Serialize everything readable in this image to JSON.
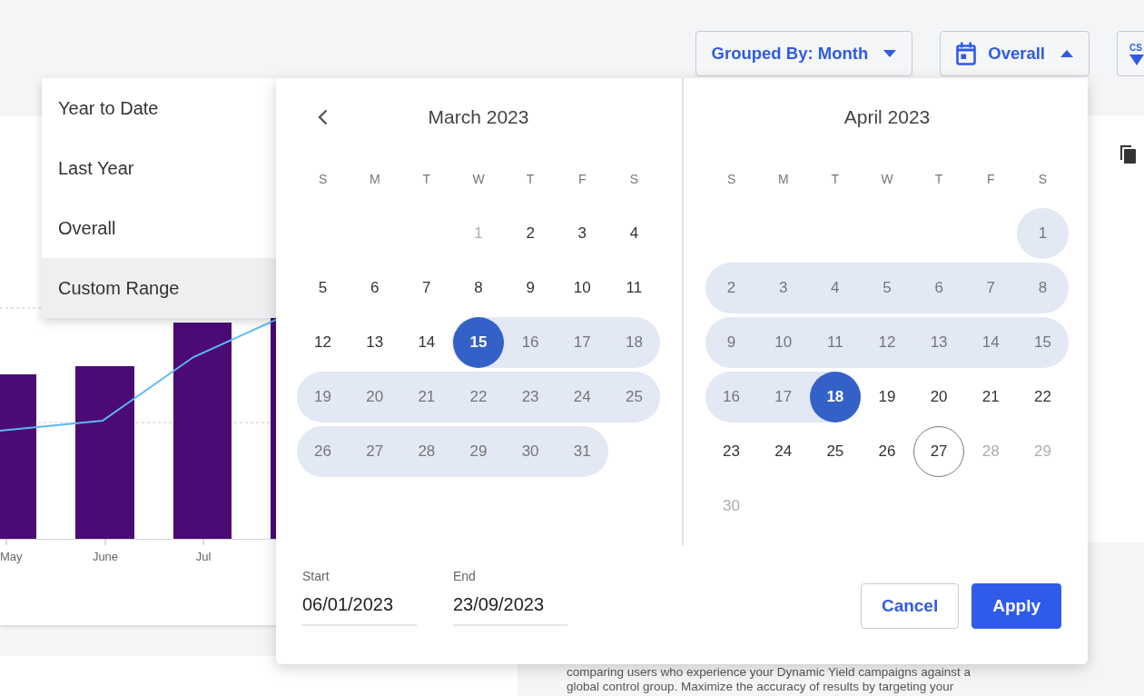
{
  "toolbar": {
    "group_by": {
      "label": "Grouped By: Month",
      "expanded": false
    },
    "date_range": {
      "label": "Overall",
      "expanded": true
    },
    "export": {
      "label": "CS"
    }
  },
  "range_menu": {
    "items": [
      {
        "label": "Year to Date",
        "selected": false
      },
      {
        "label": "Last Year",
        "selected": false
      },
      {
        "label": "Overall",
        "selected": false
      },
      {
        "label": "Custom Range",
        "selected": true
      }
    ]
  },
  "chart": {
    "x_labels": [
      "May",
      "June",
      "Jul"
    ]
  },
  "calendar": {
    "months": [
      {
        "title": "March 2023",
        "prev_arrow": true,
        "weekdays": [
          "S",
          "M",
          "T",
          "W",
          "T",
          "F",
          "S"
        ],
        "weeks": [
          {
            "kind": "first",
            "days": [
              {
                "day": "1",
                "selected": false,
                "in_range": false,
                "today": false,
                "disabled": true
              },
              {
                "day": "2",
                "selected": false,
                "in_range": false,
                "today": false,
                "disabled": false
              },
              {
                "day": "3",
                "selected": false,
                "in_range": false,
                "today": false,
                "disabled": false
              },
              {
                "day": "4",
                "selected": false,
                "in_range": false,
                "today": false,
                "disabled": false
              }
            ]
          },
          {
            "kind": "full",
            "days": [
              {
                "day": "5",
                "selected": false,
                "in_range": false,
                "today": false,
                "disabled": false
              },
              {
                "day": "6",
                "selected": false,
                "in_range": false,
                "today": false,
                "disabled": false
              },
              {
                "day": "7",
                "selected": false,
                "in_range": false,
                "today": false,
                "disabled": false
              },
              {
                "day": "8",
                "selected": false,
                "in_range": false,
                "today": false,
                "disabled": false
              },
              {
                "day": "9",
                "selected": false,
                "in_range": false,
                "today": false,
                "disabled": false
              },
              {
                "day": "10",
                "selected": false,
                "in_range": false,
                "today": false,
                "disabled": false
              },
              {
                "day": "11",
                "selected": false,
                "in_range": false,
                "today": false,
                "disabled": false
              }
            ]
          },
          {
            "kind": "full",
            "days": [
              {
                "day": "12",
                "selected": false,
                "in_range": false,
                "today": false,
                "disabled": false
              },
              {
                "day": "13",
                "selected": false,
                "in_range": false,
                "today": false,
                "disabled": false
              },
              {
                "day": "14",
                "selected": false,
                "in_range": false,
                "today": false,
                "disabled": false
              },
              {
                "day": "15",
                "selected": true,
                "in_range": true,
                "today": false,
                "disabled": false
              },
              {
                "day": "16",
                "selected": false,
                "in_range": true,
                "today": false,
                "disabled": false
              },
              {
                "day": "17",
                "selected": false,
                "in_range": true,
                "today": false,
                "disabled": false
              },
              {
                "day": "18",
                "selected": false,
                "in_range": true,
                "today": false,
                "disabled": false
              }
            ]
          },
          {
            "kind": "full",
            "days": [
              {
                "day": "19",
                "selected": false,
                "in_range": true,
                "today": false,
                "disabled": false
              },
              {
                "day": "20",
                "selected": false,
                "in_range": true,
                "today": false,
                "disabled": false
              },
              {
                "day": "21",
                "selected": false,
                "in_range": true,
                "today": false,
                "disabled": false
              },
              {
                "day": "22",
                "selected": false,
                "in_range": true,
                "today": false,
                "disabled": false
              },
              {
                "day": "23",
                "selected": false,
                "in_range": true,
                "today": false,
                "disabled": false
              },
              {
                "day": "24",
                "selected": false,
                "in_range": true,
                "today": false,
                "disabled": false
              },
              {
                "day": "25",
                "selected": false,
                "in_range": true,
                "today": false,
                "disabled": false
              }
            ]
          },
          {
            "kind": "last",
            "days": [
              {
                "day": "26",
                "selected": false,
                "in_range": true,
                "today": false,
                "disabled": false
              },
              {
                "day": "27",
                "selected": false,
                "in_range": true,
                "today": false,
                "disabled": false
              },
              {
                "day": "28",
                "selected": false,
                "in_range": true,
                "today": false,
                "disabled": false
              },
              {
                "day": "29",
                "selected": false,
                "in_range": true,
                "today": false,
                "disabled": false
              },
              {
                "day": "30",
                "selected": false,
                "in_range": true,
                "today": false,
                "disabled": false
              },
              {
                "day": "31",
                "selected": false,
                "in_range": true,
                "today": false,
                "disabled": false
              }
            ]
          }
        ]
      },
      {
        "title": "April 2023",
        "prev_arrow": false,
        "weekdays": [
          "S",
          "M",
          "T",
          "W",
          "T",
          "F",
          "S"
        ],
        "weeks": [
          {
            "kind": "first",
            "days": [
              {
                "day": "1",
                "selected": false,
                "in_range": true,
                "today": false,
                "disabled": false
              }
            ]
          },
          {
            "kind": "full",
            "days": [
              {
                "day": "2",
                "selected": false,
                "in_range": true,
                "today": false,
                "disabled": false
              },
              {
                "day": "3",
                "selected": false,
                "in_range": true,
                "today": false,
                "disabled": false
              },
              {
                "day": "4",
                "selected": false,
                "in_range": true,
                "today": false,
                "disabled": false
              },
              {
                "day": "5",
                "selected": false,
                "in_range": true,
                "today": false,
                "disabled": false
              },
              {
                "day": "6",
                "selected": false,
                "in_range": true,
                "today": false,
                "disabled": false
              },
              {
                "day": "7",
                "selected": false,
                "in_range": true,
                "today": false,
                "disabled": false
              },
              {
                "day": "8",
                "selected": false,
                "in_range": true,
                "today": false,
                "disabled": false
              }
            ]
          },
          {
            "kind": "full",
            "days": [
              {
                "day": "9",
                "selected": false,
                "in_range": true,
                "today": false,
                "disabled": false
              },
              {
                "day": "10",
                "selected": false,
                "in_range": true,
                "today": false,
                "disabled": false
              },
              {
                "day": "11",
                "selected": false,
                "in_range": true,
                "today": false,
                "disabled": false
              },
              {
                "day": "12",
                "selected": false,
                "in_range": true,
                "today": false,
                "disabled": false
              },
              {
                "day": "13",
                "selected": false,
                "in_range": true,
                "today": false,
                "disabled": false
              },
              {
                "day": "14",
                "selected": false,
                "in_range": true,
                "today": false,
                "disabled": false
              },
              {
                "day": "15",
                "selected": false,
                "in_range": true,
                "today": false,
                "disabled": false
              }
            ]
          },
          {
            "kind": "full",
            "days": [
              {
                "day": "16",
                "selected": false,
                "in_range": true,
                "today": false,
                "disabled": false
              },
              {
                "day": "17",
                "selected": false,
                "in_range": true,
                "today": false,
                "disabled": false
              },
              {
                "day": "18",
                "selected": true,
                "in_range": true,
                "today": false,
                "disabled": false
              },
              {
                "day": "19",
                "selected": false,
                "in_range": false,
                "today": false,
                "disabled": false
              },
              {
                "day": "20",
                "selected": false,
                "in_range": false,
                "today": false,
                "disabled": false
              },
              {
                "day": "21",
                "selected": false,
                "in_range": false,
                "today": false,
                "disabled": false
              },
              {
                "day": "22",
                "selected": false,
                "in_range": false,
                "today": false,
                "disabled": false
              }
            ]
          },
          {
            "kind": "full",
            "days": [
              {
                "day": "23",
                "selected": false,
                "in_range": false,
                "today": false,
                "disabled": false
              },
              {
                "day": "24",
                "selected": false,
                "in_range": false,
                "today": false,
                "disabled": false
              },
              {
                "day": "25",
                "selected": false,
                "in_range": false,
                "today": false,
                "disabled": false
              },
              {
                "day": "26",
                "selected": false,
                "in_range": false,
                "today": false,
                "disabled": false
              },
              {
                "day": "27",
                "selected": false,
                "in_range": false,
                "today": true,
                "disabled": false
              },
              {
                "day": "28",
                "selected": false,
                "in_range": false,
                "today": false,
                "disabled": true
              },
              {
                "day": "29",
                "selected": false,
                "in_range": false,
                "today": false,
                "disabled": true
              }
            ]
          },
          {
            "kind": "last",
            "days": [
              {
                "day": "30",
                "selected": false,
                "in_range": false,
                "today": false,
                "disabled": true
              }
            ]
          }
        ]
      }
    ],
    "start": {
      "label": "Start",
      "value": "06/01/2023"
    },
    "end": {
      "label": "End",
      "value": "23/09/2023"
    },
    "buttons": [
      {
        "label": "Cancel",
        "kind": "secondary"
      },
      {
        "label": "Apply",
        "kind": "primary"
      }
    ]
  },
  "description": {
    "lines": [
      "comparing users who experience your Dynamic Yield campaigns against a",
      "global control group. Maximize the accuracy of results by targeting your"
    ]
  }
}
